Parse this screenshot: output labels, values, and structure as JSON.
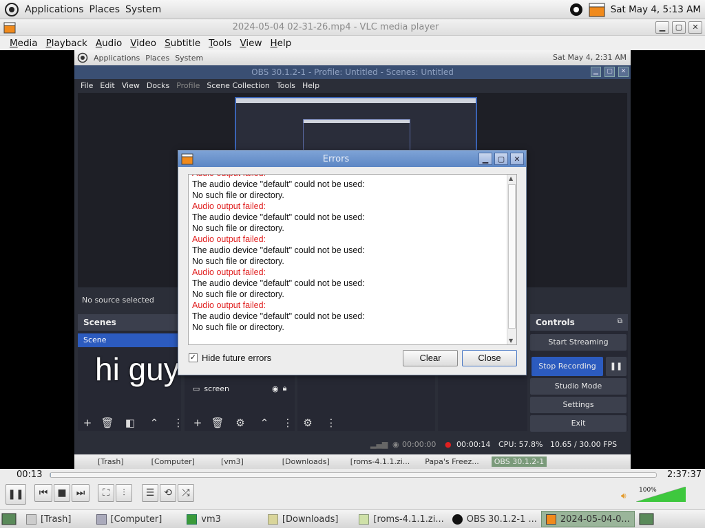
{
  "top_panel": {
    "menus": [
      "Applications",
      "Places",
      "System"
    ],
    "clock": "Sat May 4,  5:13 AM"
  },
  "vlc": {
    "title": "2024-05-04 02-31-26.mp4 - VLC media player",
    "menu": [
      "Media",
      "Playback",
      "Audio",
      "Video",
      "Subtitle",
      "Tools",
      "View",
      "Help"
    ],
    "time_elapsed": "00:13",
    "time_total": "2:37:37",
    "progress_fraction": 0.0014,
    "volume_label": "100%",
    "volume_fraction": 1.0
  },
  "video_frame": {
    "inner_panel_menus": [
      "Applications",
      "Places",
      "System"
    ],
    "inner_clock": "Sat May 4,  2:31 AM",
    "obs_title": "OBS 30.1.2-1 - Profile: Untitled - Scenes: Untitled",
    "obs_menu": [
      "File",
      "Edit",
      "View",
      "Docks",
      "Profile",
      "Scene Collection",
      "Tools",
      "Help"
    ],
    "no_source": "No source selected",
    "overlay_text": "hi guy",
    "scenes_header": "Scenes",
    "scene_item": "Scene",
    "source_item": "screen",
    "controls_header": "Controls",
    "controls": [
      "Start Streaming",
      "Stop Recording",
      "Studio Mode",
      "Settings",
      "Exit"
    ],
    "status": {
      "stream_time": "00:00:00",
      "rec_time": "00:00:14",
      "cpu": "CPU: 57.8%",
      "fps": "10.65 / 30.00 FPS"
    },
    "inner_taskbar": [
      "[Trash]",
      "[Computer]",
      "[vm3]",
      "[Downloads]",
      "[roms-4.1.1.zi...",
      "Papa's Freez...",
      "OBS 30.1.2-1"
    ]
  },
  "errors_dialog": {
    "title": "Errors",
    "lines": [
      {
        "text": "Audio output failed:",
        "error": true
      },
      {
        "text": "The audio device \"default\" could not be used:",
        "error": false
      },
      {
        "text": "No such file or directory.",
        "error": false
      },
      {
        "text": "Audio output failed:",
        "error": true
      },
      {
        "text": "The audio device \"default\" could not be used:",
        "error": false
      },
      {
        "text": "No such file or directory.",
        "error": false
      },
      {
        "text": "Audio output failed:",
        "error": true
      },
      {
        "text": "The audio device \"default\" could not be used:",
        "error": false
      },
      {
        "text": "No such file or directory.",
        "error": false
      },
      {
        "text": "Audio output failed:",
        "error": true
      },
      {
        "text": "The audio device \"default\" could not be used:",
        "error": false
      },
      {
        "text": "No such file or directory.",
        "error": false
      },
      {
        "text": "Audio output failed:",
        "error": true
      },
      {
        "text": "The audio device \"default\" could not be used:",
        "error": false
      },
      {
        "text": "No such file or directory.",
        "error": false
      }
    ],
    "hide_future_label": "Hide future errors",
    "hide_future_checked": true,
    "clear_label": "Clear",
    "close_label": "Close"
  },
  "taskbar": {
    "items": [
      "[Trash]",
      "[Computer]",
      "vm3",
      "[Downloads]",
      "[roms-4.1.1.zi...",
      "OBS 30.1.2-1 ...",
      "2024-05-04-0..."
    ]
  },
  "colors": {
    "error_red": "#e02020",
    "obs_blue": "#2c5bbf",
    "obs_bg": "#2b2e38"
  }
}
